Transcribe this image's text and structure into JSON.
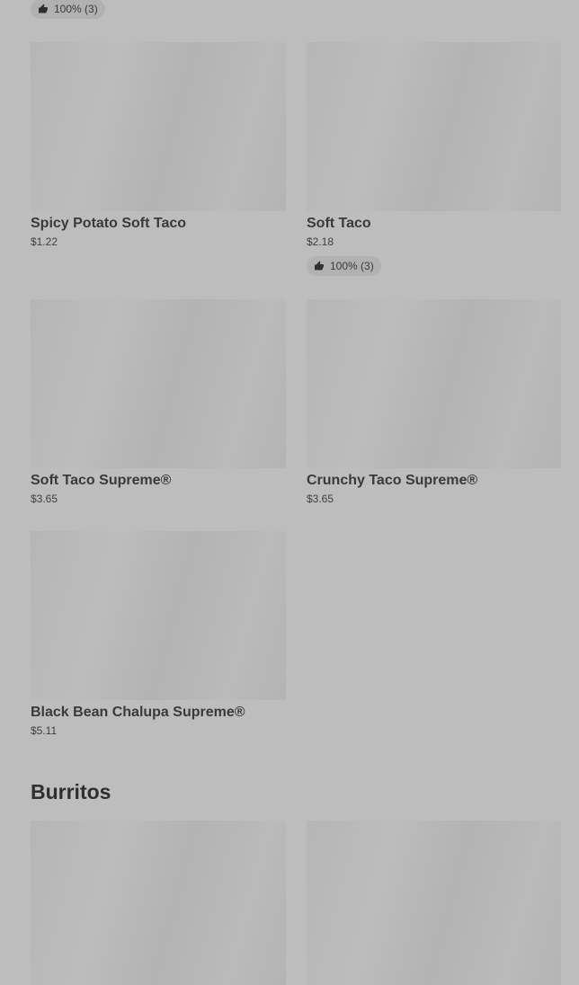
{
  "top_rating": {
    "text": "100% (3)"
  },
  "items": [
    {
      "name": "Spicy Potato Soft Taco",
      "price": "$1.22"
    },
    {
      "name": "Soft Taco",
      "price": "$2.18",
      "rating": "100% (3)"
    },
    {
      "name": "Soft Taco Supreme®",
      "price": "$3.65"
    },
    {
      "name": "Crunchy Taco Supreme®",
      "price": "$3.65"
    },
    {
      "name": "Black Bean Chalupa Supreme®",
      "price": "$5.11"
    }
  ],
  "sections": {
    "burritos": {
      "title": "Burritos"
    }
  },
  "icons": {
    "rating": "thumbs-up-icon"
  },
  "colors": {
    "background": "#bdbdbd",
    "placeholder": "#b6b6b6",
    "text": "#333333"
  }
}
